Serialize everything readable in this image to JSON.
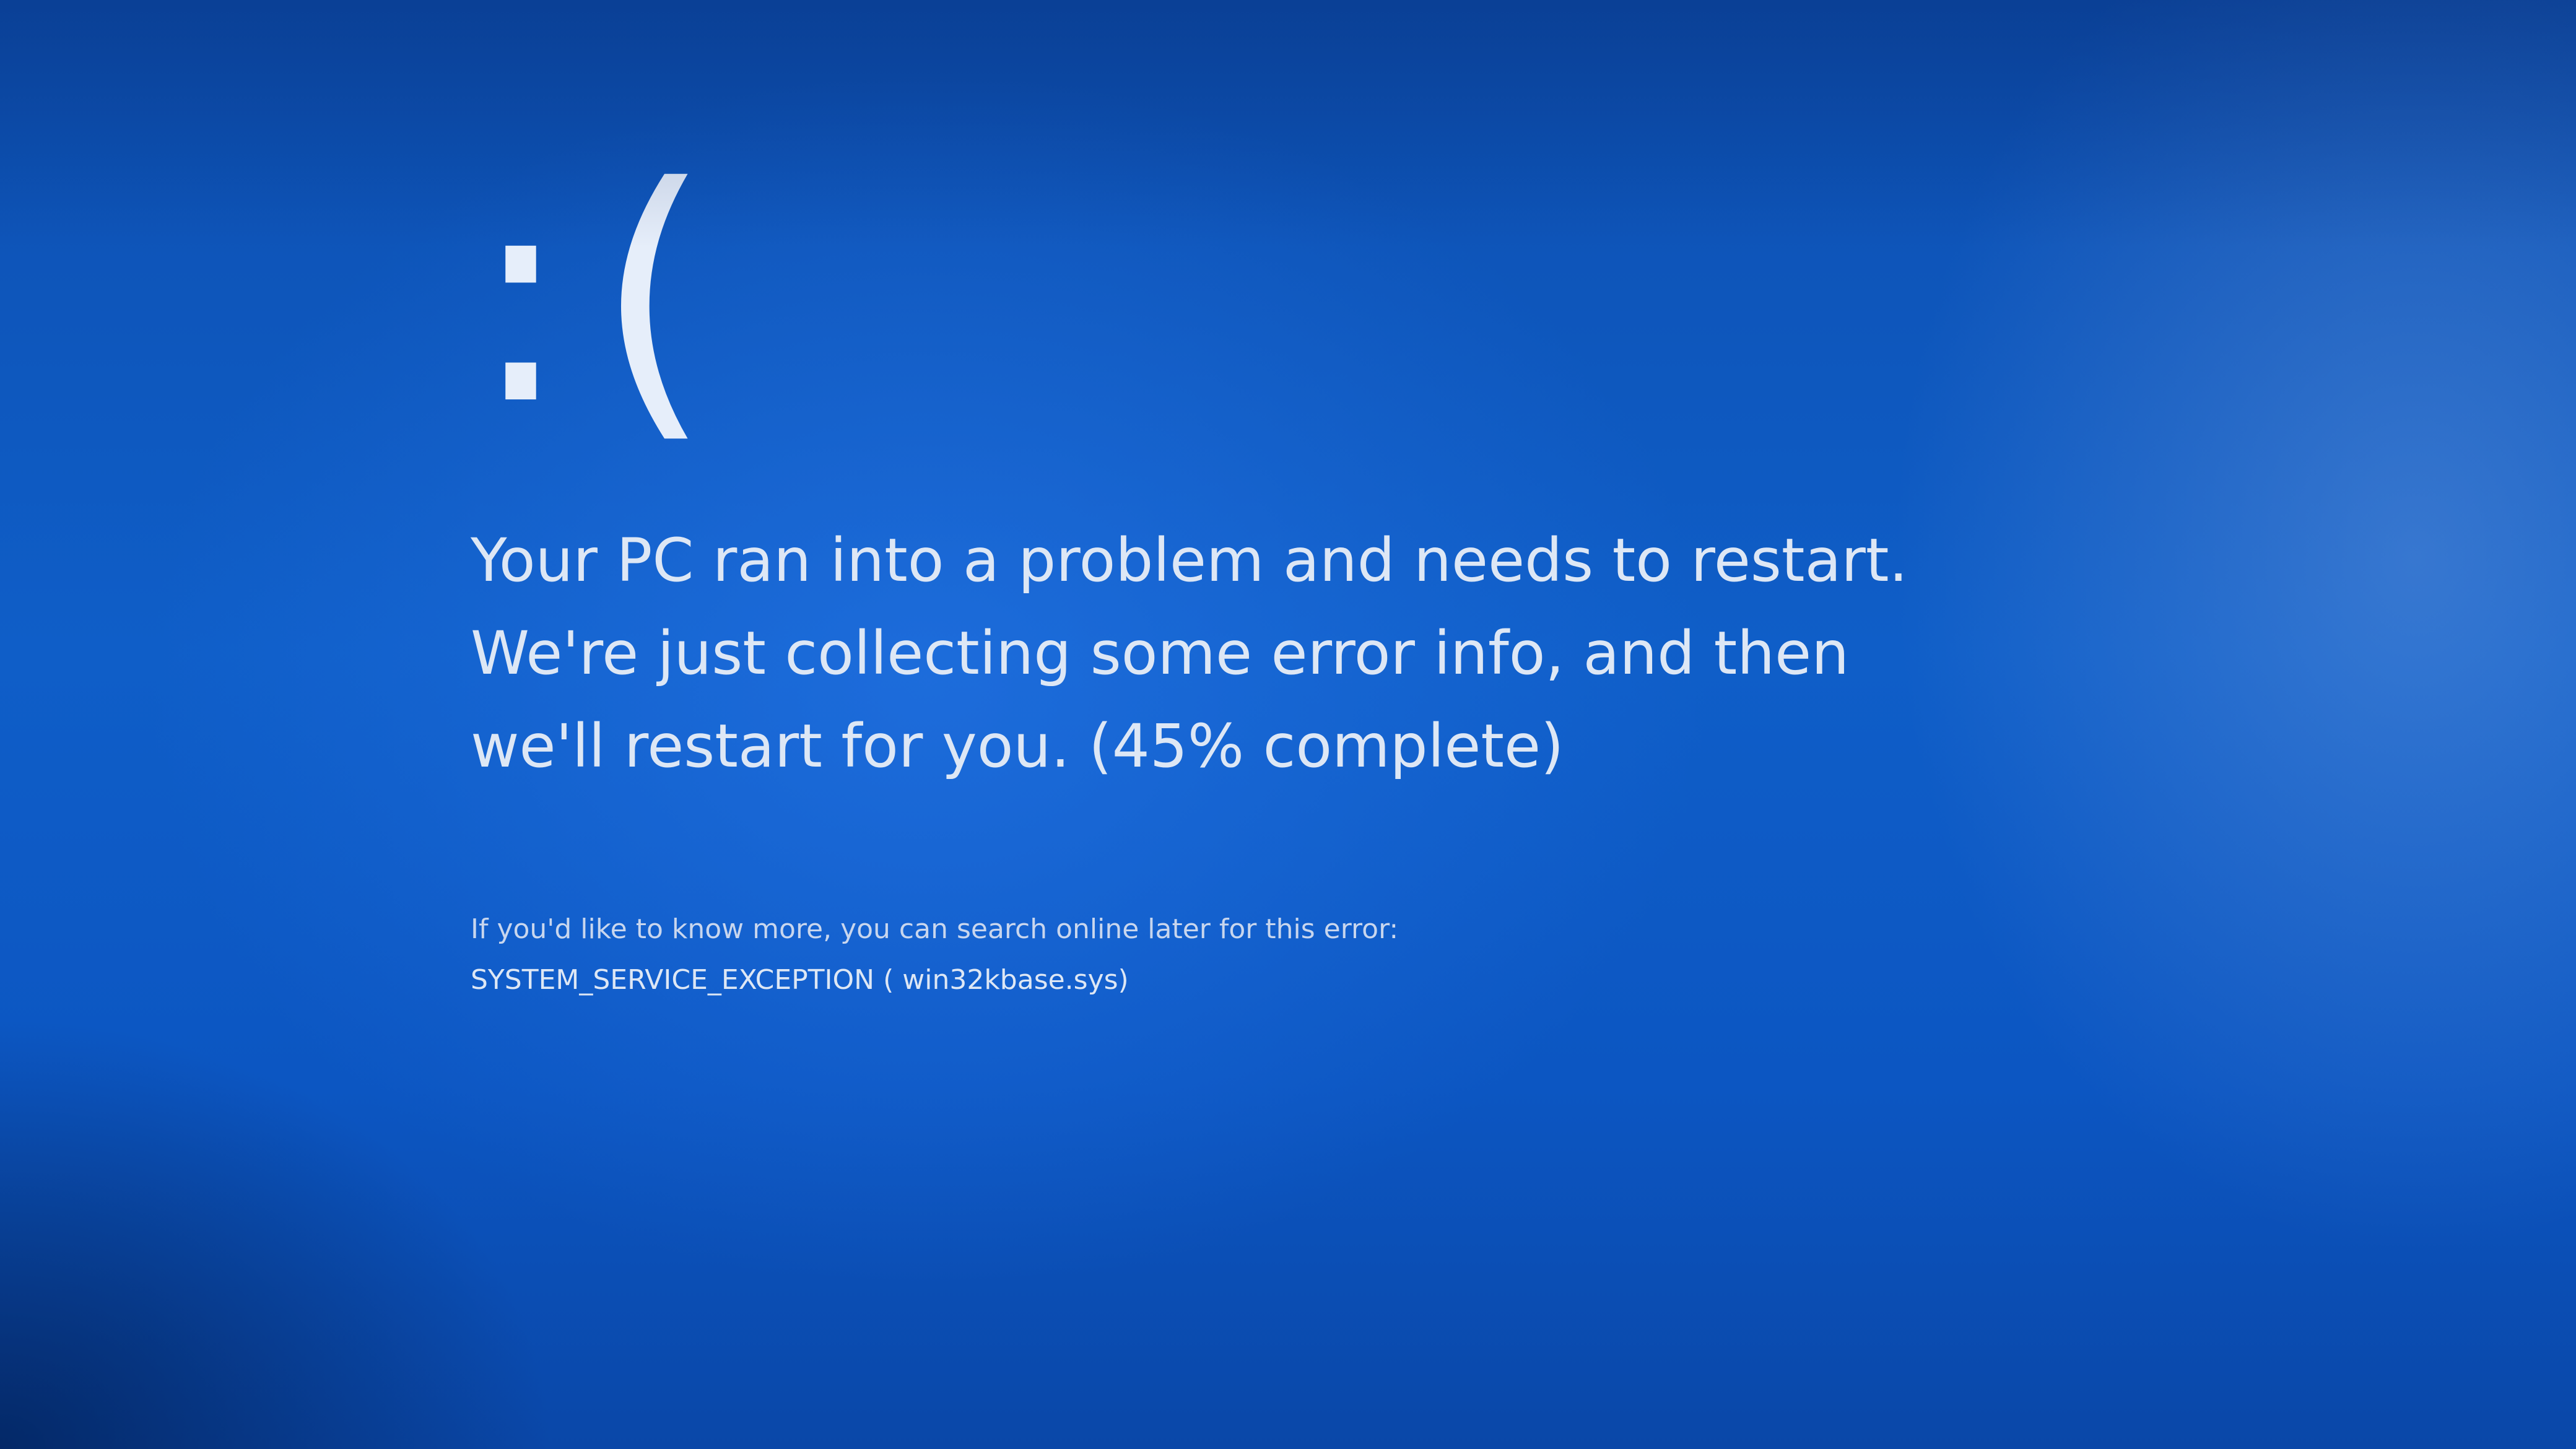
{
  "bsod": {
    "sad_face": ":(",
    "message_line_1": "Your PC ran into a problem and needs to restart.",
    "message_line_2": "We're just collecting some error info, and then",
    "message_line_3_prefix": "we'll restart for you. (",
    "progress_percent": "45%",
    "message_line_3_suffix": " complete)",
    "details_prefix": "If you'd like to know more, you can search online later for this error: ",
    "stop_code": "SYSTEM_SERVICE_EXCEPTION",
    "failing_module": "( win32kbase.sys)",
    "progress_value": 45,
    "background_color": "#0f5ec8",
    "text_color": "#dde7f5"
  }
}
